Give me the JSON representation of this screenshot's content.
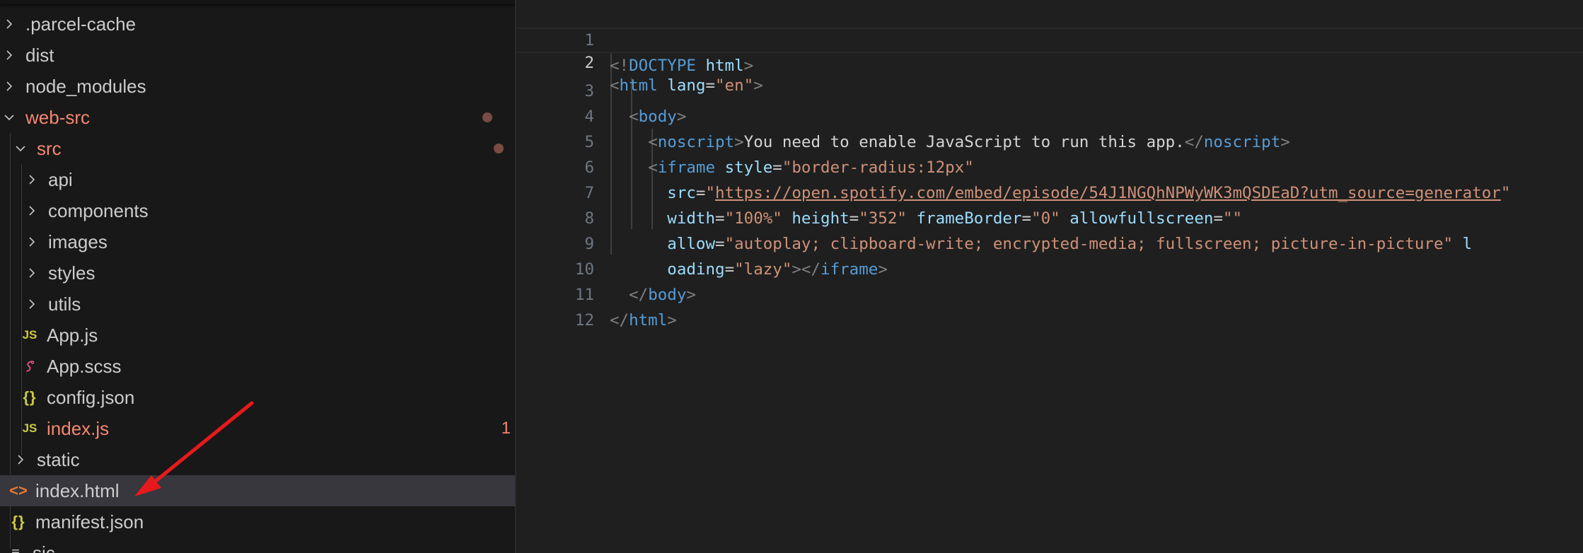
{
  "explorer": {
    "items": [
      {
        "label": ".parcel-cache",
        "kind": "folder"
      },
      {
        "label": "dist",
        "kind": "folder"
      },
      {
        "label": "node_modules",
        "kind": "folder"
      },
      {
        "label": "web-src",
        "kind": "folder-open"
      },
      {
        "label": "src",
        "kind": "folder-open"
      },
      {
        "label": "api",
        "kind": "folder"
      },
      {
        "label": "components",
        "kind": "folder"
      },
      {
        "label": "images",
        "kind": "folder"
      },
      {
        "label": "styles",
        "kind": "folder"
      },
      {
        "label": "utils",
        "kind": "folder"
      },
      {
        "label": "App.js",
        "kind": "js",
        "icon_text": "JS"
      },
      {
        "label": "App.scss",
        "kind": "scss"
      },
      {
        "label": "config.json",
        "kind": "json",
        "icon_text": "{}"
      },
      {
        "label": "index.js",
        "kind": "js",
        "icon_text": "JS",
        "problems": "1"
      },
      {
        "label": "static",
        "kind": "folder"
      },
      {
        "label": "index.html",
        "kind": "html",
        "icon_text": "<>"
      },
      {
        "label": "manifest.json",
        "kind": "json",
        "icon_text": "{}"
      },
      {
        "label": "sic",
        "kind": "file"
      }
    ],
    "selected": "index.html"
  },
  "editor": {
    "line_numbers": [
      "1",
      "2",
      "3",
      "4",
      "5",
      "6",
      "7",
      "8",
      "9",
      "10",
      "11",
      "12"
    ],
    "active_line": "2"
  },
  "colors": {
    "sidebar_bg": "#181818",
    "editor_bg": "#1f1f1f",
    "modified_red": "#f48771",
    "annotation_arrow": "#e8191c"
  }
}
